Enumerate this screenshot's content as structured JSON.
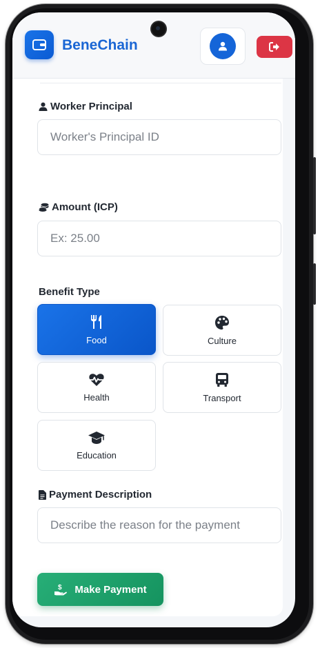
{
  "app": {
    "brand": "BeneChain"
  },
  "header": {
    "logo_icon": "wallet-icon",
    "profile_icon": "user-icon",
    "logout_icon": "sign-out-icon"
  },
  "form": {
    "worker": {
      "label": "Worker Principal",
      "placeholder": "Worker's Principal ID",
      "icon": "user-icon"
    },
    "amount": {
      "label": "Amount (ICP)",
      "placeholder": "Ex: 25.00",
      "icon": "coins-icon"
    },
    "benefit": {
      "label": "Benefit Type",
      "selected": "Food",
      "options": [
        {
          "label": "Food",
          "icon": "utensils-icon"
        },
        {
          "label": "Culture",
          "icon": "palette-icon"
        },
        {
          "label": "Health",
          "icon": "heartbeat-icon"
        },
        {
          "label": "Transport",
          "icon": "bus-icon"
        },
        {
          "label": "Education",
          "icon": "graduation-cap-icon"
        }
      ]
    },
    "description": {
      "label": "Payment Description",
      "placeholder": "Describe the reason for the payment",
      "icon": "file-icon"
    },
    "submit": {
      "label": "Make Payment",
      "icon": "hand-coin-icon"
    }
  },
  "colors": {
    "primary": "#1a66d4",
    "danger": "#dc3545",
    "success": "#1fa26a",
    "text": "#222831"
  }
}
